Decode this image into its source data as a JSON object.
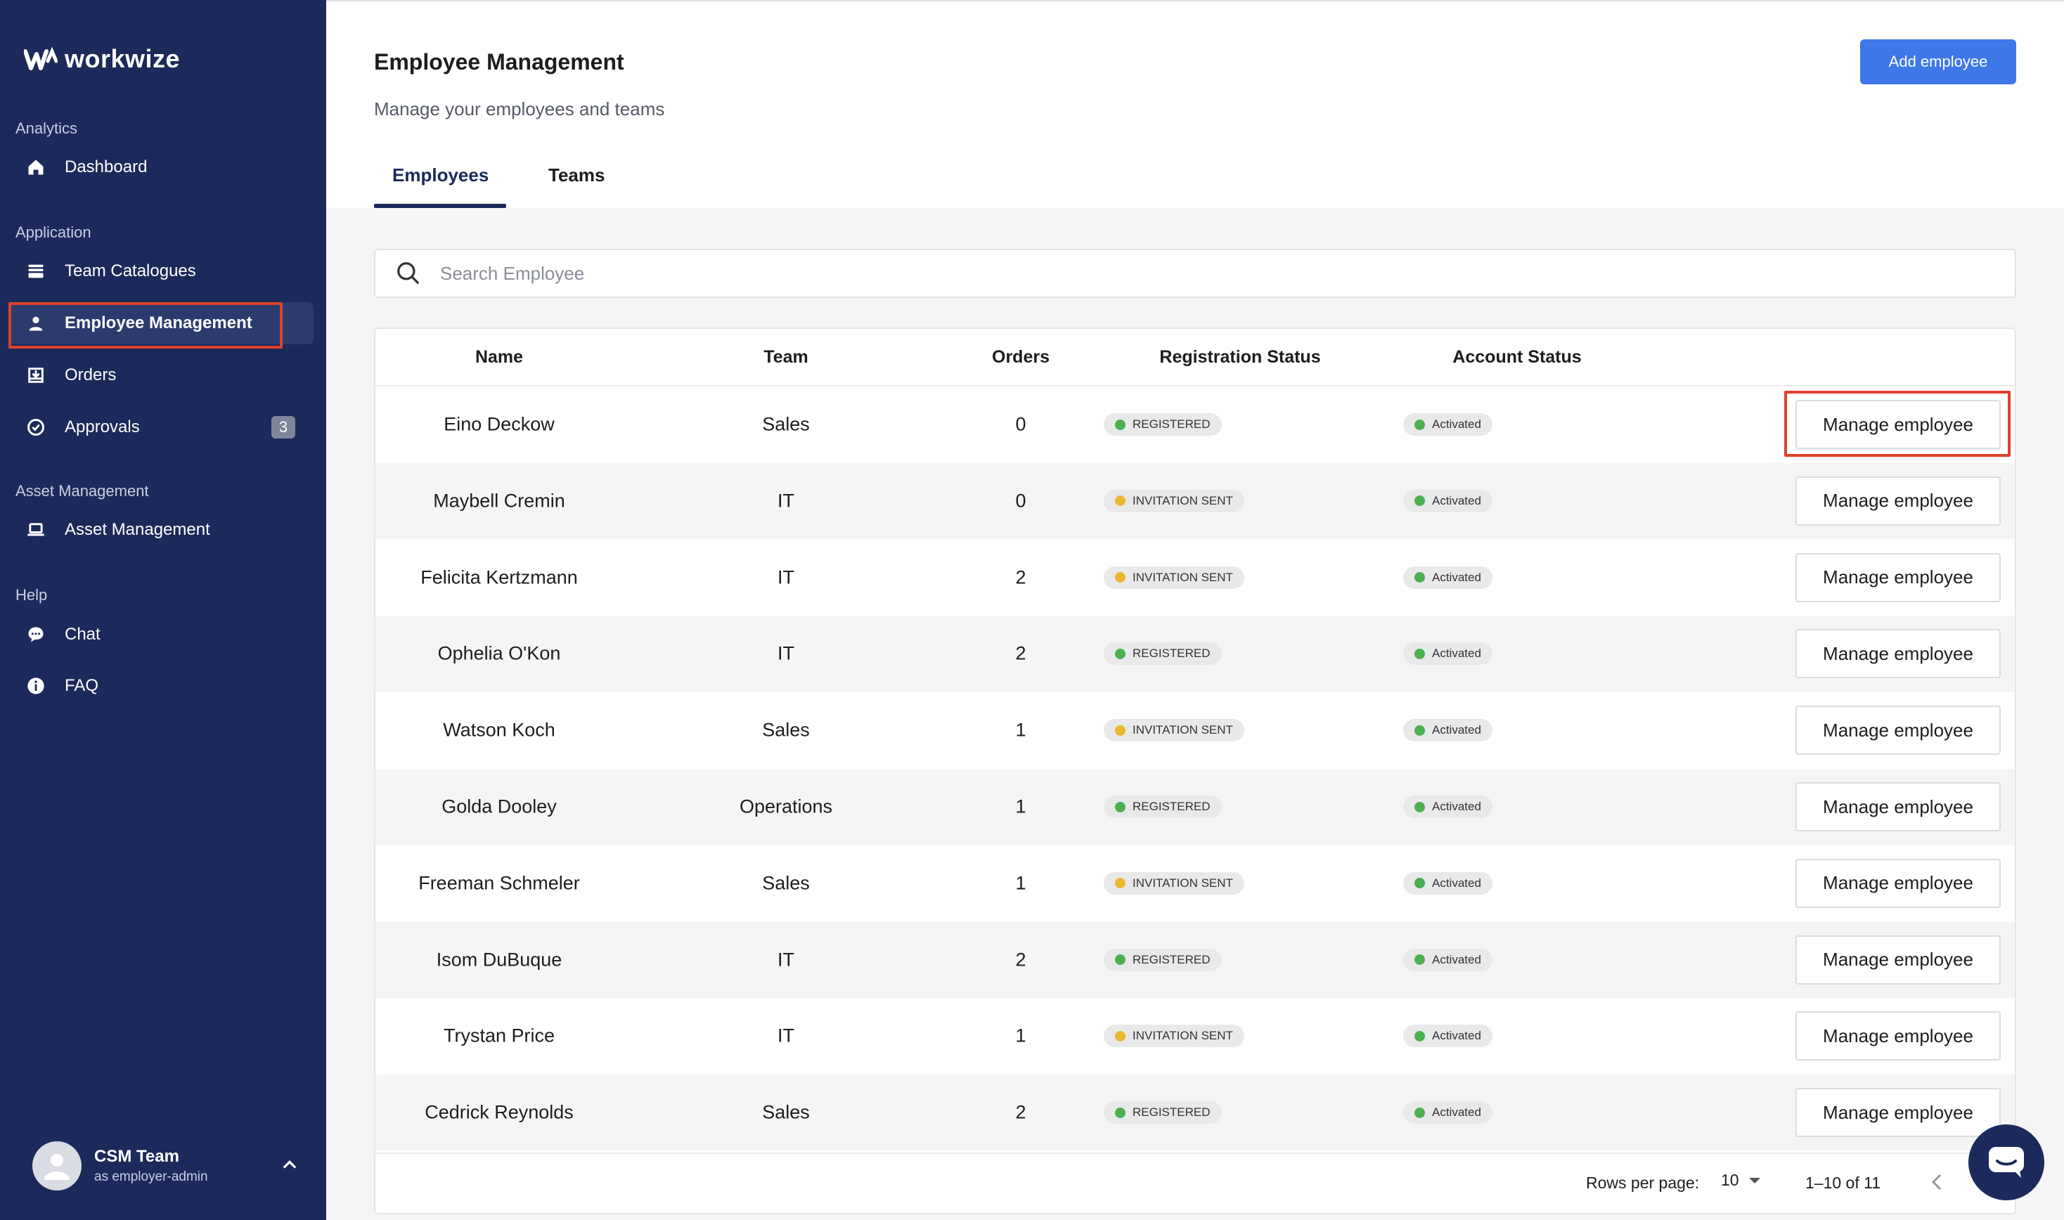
{
  "brand": {
    "name": "workwize"
  },
  "sidebar": {
    "sections": [
      {
        "label": "Analytics"
      },
      {
        "label": "Application"
      },
      {
        "label": "Asset Management"
      },
      {
        "label": "Help"
      }
    ],
    "items": [
      {
        "label": "Dashboard",
        "icon": "home-icon"
      },
      {
        "label": "Team Catalogues",
        "icon": "catalogue-icon"
      },
      {
        "label": "Employee Management",
        "icon": "person-icon",
        "active": true
      },
      {
        "label": "Orders",
        "icon": "download-box-icon"
      },
      {
        "label": "Approvals",
        "icon": "check-circle-icon",
        "badge": "3"
      },
      {
        "label": "Asset Management",
        "icon": "laptop-icon"
      },
      {
        "label": "Chat",
        "icon": "chat-bubble-icon"
      },
      {
        "label": "FAQ",
        "icon": "info-icon"
      }
    ],
    "user": {
      "name": "CSM Team",
      "role": "as employer-admin"
    }
  },
  "header": {
    "title": "Employee Management",
    "subtitle": "Manage your employees and teams",
    "add_button": "Add employee",
    "tabs": [
      {
        "label": "Employees",
        "active": true
      },
      {
        "label": "Teams",
        "active": false
      }
    ]
  },
  "search": {
    "placeholder": "Search Employee",
    "value": ""
  },
  "table": {
    "columns": [
      "Name",
      "Team",
      "Orders",
      "Registration Status",
      "Account Status"
    ],
    "action_label": "Manage employee",
    "rows": [
      {
        "name": "Eino Deckow",
        "team": "Sales",
        "orders": "0",
        "registration": "REGISTERED",
        "account": "Activated"
      },
      {
        "name": "Maybell Cremin",
        "team": "IT",
        "orders": "0",
        "registration": "INVITATION SENT",
        "account": "Activated"
      },
      {
        "name": "Felicita Kertzmann",
        "team": "IT",
        "orders": "2",
        "registration": "INVITATION SENT",
        "account": "Activated"
      },
      {
        "name": "Ophelia O'Kon",
        "team": "IT",
        "orders": "2",
        "registration": "REGISTERED",
        "account": "Activated"
      },
      {
        "name": "Watson Koch",
        "team": "Sales",
        "orders": "1",
        "registration": "INVITATION SENT",
        "account": "Activated"
      },
      {
        "name": "Golda Dooley",
        "team": "Operations",
        "orders": "1",
        "registration": "REGISTERED",
        "account": "Activated"
      },
      {
        "name": "Freeman Schmeler",
        "team": "Sales",
        "orders": "1",
        "registration": "INVITATION SENT",
        "account": "Activated"
      },
      {
        "name": "Isom DuBuque",
        "team": "IT",
        "orders": "2",
        "registration": "REGISTERED",
        "account": "Activated"
      },
      {
        "name": "Trystan Price",
        "team": "IT",
        "orders": "1",
        "registration": "INVITATION SENT",
        "account": "Activated"
      },
      {
        "name": "Cedrick Reynolds",
        "team": "Sales",
        "orders": "2",
        "registration": "REGISTERED",
        "account": "Activated"
      }
    ]
  },
  "pagination": {
    "rows_per_page_label": "Rows per page:",
    "rows_per_page": "10",
    "range": "1–10 of 11"
  },
  "colors": {
    "sidebar_bg": "#1b2a5a",
    "accent": "#3e78e8",
    "highlight": "#e0402b",
    "registered_dot": "#4caf50",
    "invitation_dot": "#e8b931",
    "activated_dot": "#4caf50"
  }
}
